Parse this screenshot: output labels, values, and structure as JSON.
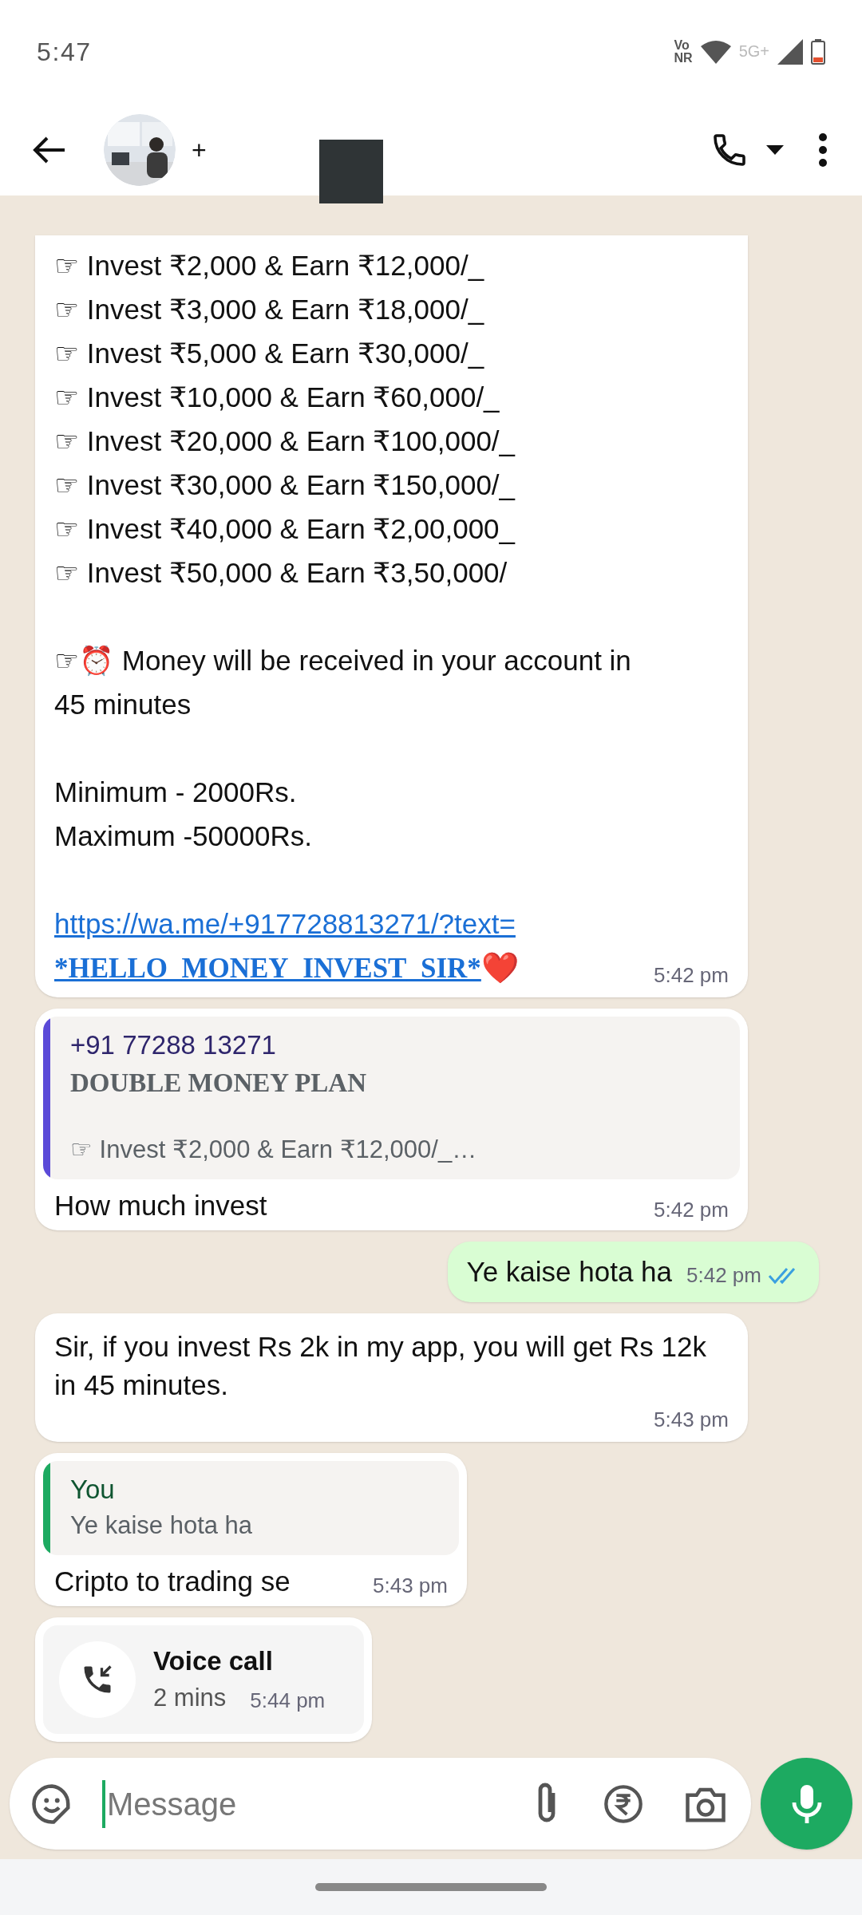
{
  "status_bar": {
    "time": "5:47",
    "volte": "Vo",
    "volte_sub": "NR",
    "network": "5G+"
  },
  "header": {
    "contact_name": "+"
  },
  "messages": [
    {
      "kind": "offer",
      "outgoing": false,
      "paragraphs": [
        [
          "☞ Invest ₹2,000 & Earn ₹12,000/_",
          "☞ Invest ₹3,000 & Earn ₹18,000/_",
          "☞ Invest ₹5,000 & Earn ₹30,000/_",
          "☞ Invest ₹10,000 & Earn ₹60,000/_",
          "☞ Invest ₹20,000 & Earn ₹100,000/_",
          "☞ Invest ₹30,000 & Earn ₹150,000/_",
          "☞ Invest ₹40,000 & Earn ₹2,00,000_",
          "☞ Invest ₹50,000 & Earn ₹3,50,000/"
        ],
        [
          "☞⏰ Money will be received in your account in 45 minutes"
        ],
        [
          "Minimum - 2000Rs.",
          "Maximum -50000Rs."
        ]
      ],
      "link_lines": [
        "https://wa.me/+917728813271/?text=",
        "*HELLO_MONEY_INVEST_SIR*"
      ],
      "heart": "❤️",
      "time": "5:42 pm"
    },
    {
      "kind": "reply",
      "outgoing": false,
      "quote": {
        "sender": "+91 77288 13271",
        "title": "DOUBLE MONEY PLAN",
        "snippet": "☞ Invest ₹2,000 & Earn ₹12,000/_…",
        "color": "#5b4ad8"
      },
      "text": "How much invest",
      "time": "5:42 pm"
    },
    {
      "kind": "text",
      "outgoing": true,
      "text": "Ye kaise hota ha",
      "time": "5:42 pm",
      "read": true
    },
    {
      "kind": "text",
      "outgoing": false,
      "text": "Sir, if you invest Rs 2k in my app, you will get Rs 12k in 45 minutes.",
      "time": "5:43 pm"
    },
    {
      "kind": "reply",
      "outgoing": false,
      "quote": {
        "sender": "You",
        "snippet": "Ye kaise hota ha",
        "color": "#1daa61"
      },
      "text": "Cripto to trading se",
      "time": "5:43 pm"
    },
    {
      "kind": "call",
      "outgoing": false,
      "title": "Voice call",
      "duration": "2 mins",
      "time": "5:44 pm"
    }
  ],
  "composer": {
    "placeholder": "Message"
  }
}
